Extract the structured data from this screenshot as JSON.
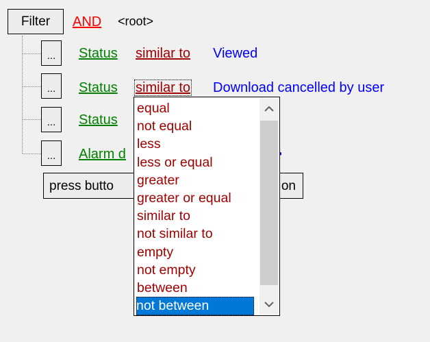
{
  "filter": {
    "filter_button": "Filter",
    "operator": "AND",
    "root_label": "<root>"
  },
  "conditions": [
    {
      "dots": "...",
      "field": "Status",
      "comparison": "similar to",
      "value": "Viewed"
    },
    {
      "dots": "...",
      "field": "Status",
      "comparison": "similar to",
      "value": "Download cancelled by user"
    },
    {
      "dots": "...",
      "field": "Status"
    },
    {
      "dots": "...",
      "field": "Alarm d",
      "value_fragment": ">"
    }
  ],
  "add_condition_button": {
    "left_text": "press butto",
    "right_text": "on"
  },
  "dropdown": {
    "options": [
      "equal",
      "not equal",
      "less",
      "less or equal",
      "greater",
      "greater or equal",
      "similar to",
      "not similar to",
      "empty",
      "not empty",
      "between",
      "not between"
    ],
    "selected": "not between"
  },
  "colors": {
    "field": "#008000",
    "comparison": "#a00000",
    "operator": "#ff0000",
    "value": "#0000ff",
    "selection": "#0078d7"
  },
  "icons": {
    "scroll_up": "chevron-up-icon",
    "scroll_down": "chevron-down-icon"
  }
}
